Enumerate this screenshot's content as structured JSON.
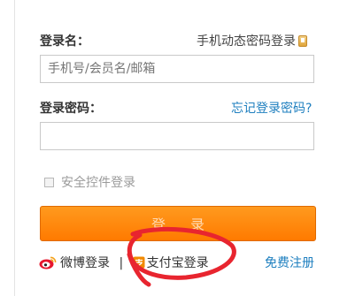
{
  "form": {
    "username_label": "登录名：",
    "mobile_login_link": "手机动态密码登录",
    "username_placeholder": "手机号/会员名/邮箱",
    "password_label": "登录密码：",
    "forgot_password_link": "忘记登录密码?",
    "password_value": "",
    "security_control_label": "安全控件登录",
    "security_control_checked": false,
    "login_button_label": "登录"
  },
  "footer": {
    "weibo_login": "微博登录",
    "separator": "|",
    "alipay_login": "支付宝登录",
    "register_link": "免费注册"
  },
  "colors": {
    "accent_orange": "#ff8a0f",
    "link_blue": "#1e7fbf",
    "annotation_red": "#e8252f"
  },
  "icons": {
    "mobile": "mobile-phone-icon",
    "weibo": "weibo-icon",
    "alipay": "alipay-icon",
    "checkbox": "checkbox-icon"
  }
}
